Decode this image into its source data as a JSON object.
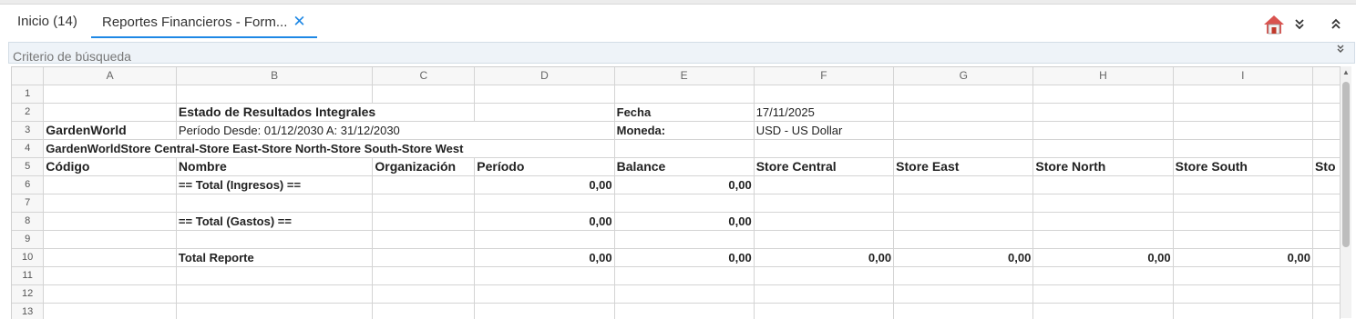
{
  "tabs": [
    {
      "label": "Inicio (14)"
    },
    {
      "label": "Reportes Financieros - Form..."
    }
  ],
  "toolbar": {
    "home_icon": "home-icon",
    "collapse_icon": "chevrons-down-icon",
    "expand_icon": "chevrons-up-icon"
  },
  "search": {
    "label": "Criterio de búsqueda"
  },
  "columns": [
    "A",
    "B",
    "C",
    "D",
    "E",
    "F",
    "G",
    "H",
    "I"
  ],
  "rows": [
    "1",
    "2",
    "3",
    "4",
    "5",
    "6",
    "7",
    "8",
    "9",
    "10",
    "11",
    "12",
    "13"
  ],
  "report": {
    "title": "Estado de Resultados Integrales",
    "fecha_label": "Fecha",
    "fecha_value": "17/11/2025",
    "company": "GardenWorld",
    "period": "Período Desde: 01/12/2030 A: 31/12/2030",
    "moneda_label": "Moneda:",
    "moneda_value": "USD - US Dollar",
    "orgs": "GardenWorldStore Central-Store East-Store North-Store South-Store West",
    "headers": [
      "Código",
      "Nombre",
      "Organización",
      "Período",
      "Balance",
      "Store Central",
      "Store East",
      "Store North",
      "Store South",
      "Sto"
    ],
    "total_ingresos": "== Total (Ingresos) ==",
    "total_gastos": "== Total (Gastos) ==",
    "total_reporte": "Total Reporte",
    "zero": "0,00"
  }
}
